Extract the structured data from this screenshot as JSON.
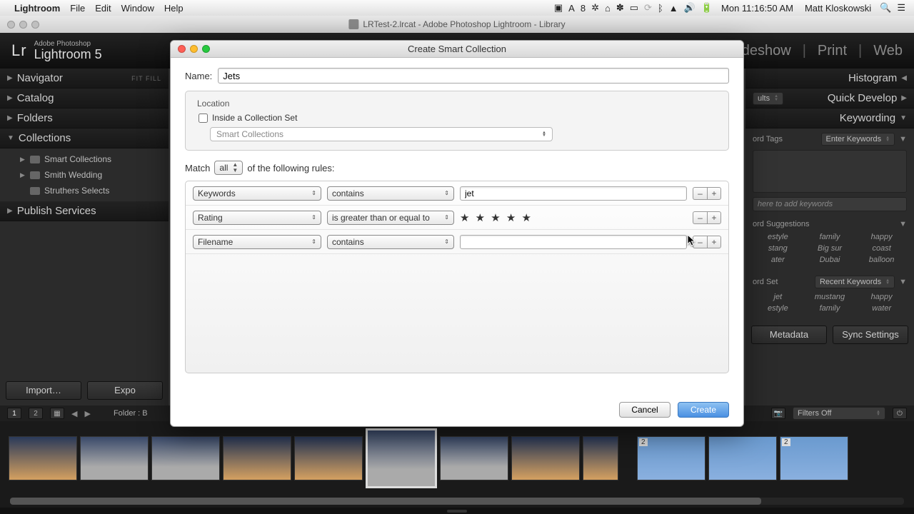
{
  "menubar": {
    "app": "Lightroom",
    "items": [
      "File",
      "Edit",
      "Window",
      "Help"
    ],
    "clock": "Mon 11:16:50 AM",
    "user": "Matt Kloskowski"
  },
  "window": {
    "title": "LRTest-2.lrcat - Adobe Photoshop Lightroom - Library"
  },
  "header": {
    "brand_sub1": "Adobe Photoshop",
    "brand_main": "Lightroom 5",
    "modules": [
      "deshow",
      "Print",
      "Web"
    ]
  },
  "left": {
    "navigator": {
      "label": "Navigator",
      "hints": "FIT   FILL"
    },
    "catalog": "Catalog",
    "folders": "Folders",
    "collections": {
      "label": "Collections",
      "items": [
        "Smart Collections",
        "Smith Wedding",
        "Struthers Selects"
      ]
    },
    "publish": "Publish Services",
    "import_btn": "Import…",
    "export_btn": "Expo"
  },
  "right": {
    "histogram": "Histogram",
    "quickdev": "Quick Develop",
    "quickdev_hint": "ults",
    "keywording": "Keywording",
    "kw_tags": "ord Tags",
    "kw_enter": "Enter Keywords",
    "kw_placeholder": "here to add keywords",
    "suggestions": {
      "label": "ord Suggestions",
      "items": [
        "estyle",
        "family",
        "happy",
        "stang",
        "Big sur",
        "coast",
        "ater",
        "Dubai",
        "balloon"
      ]
    },
    "kwset_label": "ord Set",
    "kwset_sel": "Recent Keywords",
    "kwset_items": [
      "jet",
      "mustang",
      "happy",
      "estyle",
      "family",
      "water"
    ],
    "sync_meta": "Metadata",
    "sync_set": "Sync Settings"
  },
  "filmstrip": {
    "nums": [
      "1",
      "2"
    ],
    "folder": "Folder : B",
    "filters": "Filters Off",
    "badge2": "2"
  },
  "dialog": {
    "title": "Create Smart Collection",
    "name_label": "Name:",
    "name_value": "Jets",
    "location_label": "Location",
    "inside_label": "Inside a Collection Set",
    "collset_sel": "Smart Collections",
    "match_pre": "Match",
    "match_sel": "all",
    "match_post": "of the following rules:",
    "rules": [
      {
        "attr": "Keywords",
        "op": "contains",
        "val": "jet"
      },
      {
        "attr": "Rating",
        "op": "is greater than or equal to",
        "stars": "★ ★ ★ ★ ★"
      },
      {
        "attr": "Filename",
        "op": "contains",
        "val": ""
      }
    ],
    "minus": "–",
    "plus": "+",
    "cancel": "Cancel",
    "create": "Create"
  }
}
